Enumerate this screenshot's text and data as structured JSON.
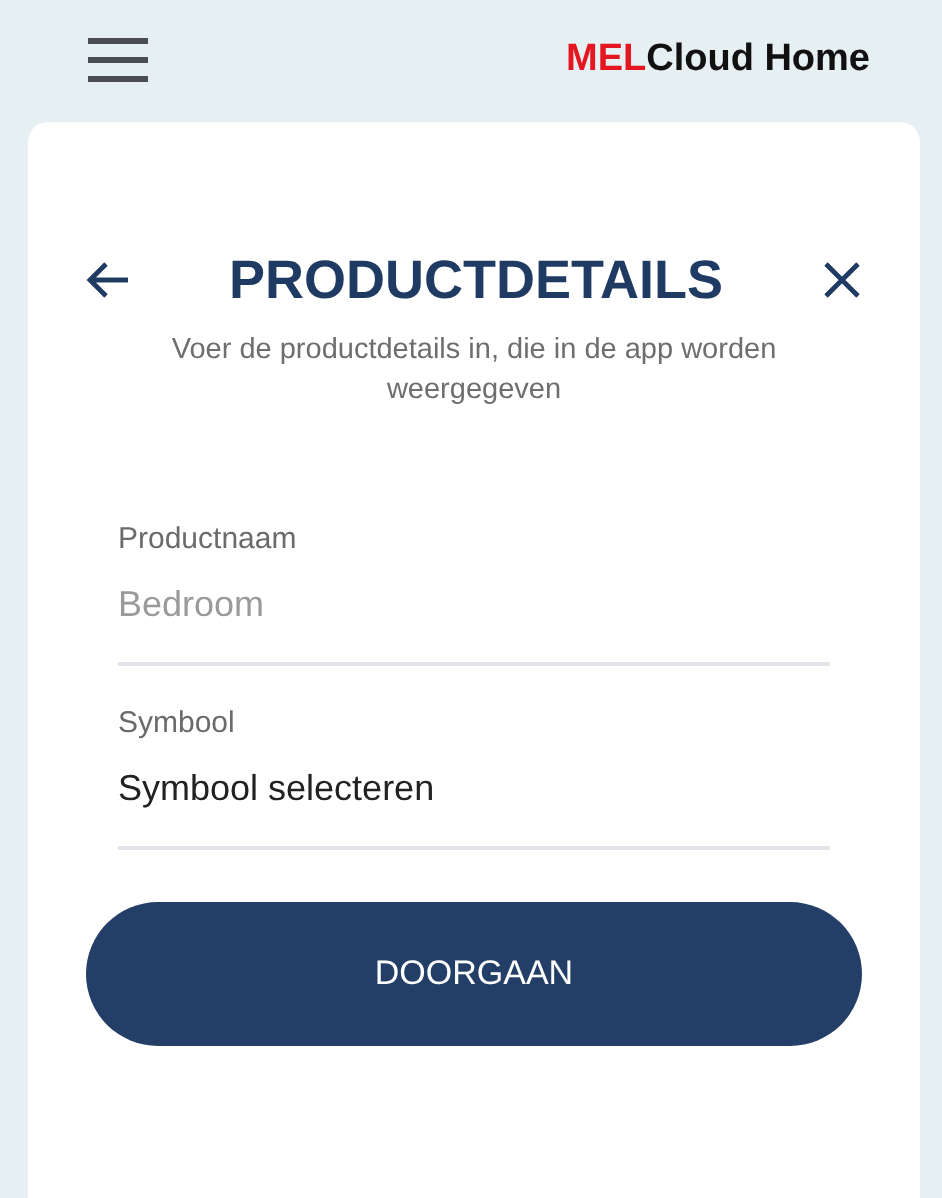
{
  "header": {
    "logo": {
      "brand_mark": "MEL",
      "brand_name": "Cloud Home"
    }
  },
  "dialog": {
    "title": "PRODUCTDETAILS",
    "subtitle": "Voer de productdetails in, die in de app worden weergegeven",
    "fields": [
      {
        "label": "Productnaam",
        "placeholder": "Bedroom"
      },
      {
        "label": "Symbool",
        "value": "Symbool selecteren"
      }
    ],
    "button": "DOORGAAN"
  }
}
